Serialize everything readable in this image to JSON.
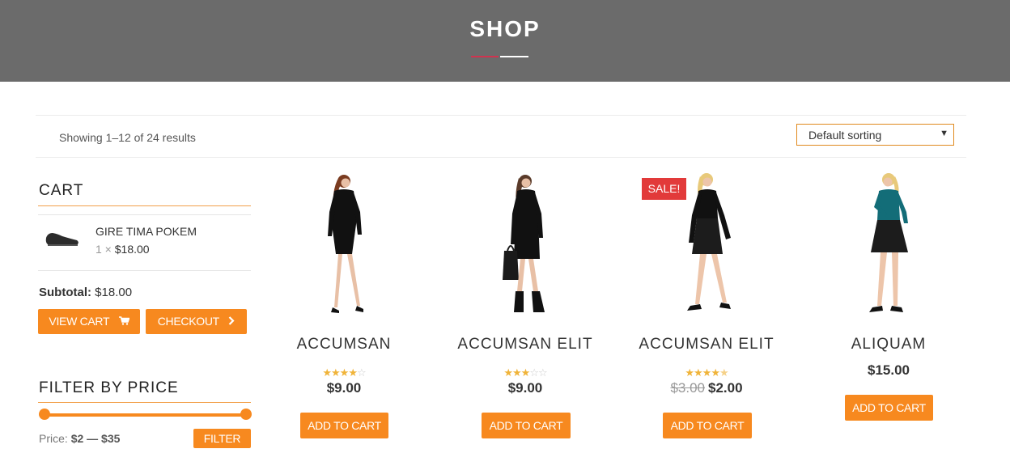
{
  "page": {
    "title": "SHOP"
  },
  "toolbar": {
    "result_count": "Showing 1–12 of 24 results",
    "sort_value": "Default sorting"
  },
  "cart": {
    "title": "CART",
    "item": {
      "name": "GIRE TIMA POKEM",
      "qty": "1 ×",
      "price": "$18.00"
    },
    "subtotal_label": "Subtotal:",
    "subtotal_value": "$18.00",
    "view_cart_label": "VIEW CART",
    "checkout_label": "CHECKOUT"
  },
  "filter": {
    "title": "FILTER BY PRICE",
    "price_label": "Price:",
    "price_range": "$2 — $35",
    "range_min": 2,
    "range_max": 35,
    "button_label": "FILTER"
  },
  "products": [
    {
      "name": "ACCUMSAN",
      "rating": 4,
      "price": "$9.00",
      "old_price": "",
      "button": "ADD TO CART",
      "sale": false
    },
    {
      "name": "ACCUMSAN ELIT",
      "rating": 3,
      "price": "$9.00",
      "old_price": "",
      "button": "ADD TO CART",
      "sale": false
    },
    {
      "name": "ACCUMSAN ELIT",
      "rating": 4.5,
      "price": "$2.00",
      "old_price": "$3.00",
      "button": "ADD TO CART",
      "sale": true,
      "sale_label": "SALE!"
    },
    {
      "name": "ALIQUAM",
      "rating": null,
      "price": "$15.00",
      "old_price": "",
      "button": "ADD TO CART",
      "sale": false
    }
  ],
  "colors": {
    "accent": "#f7891f",
    "header_bg": "#6b6b6b",
    "sale": "#e23a3a",
    "star": "#f0b43a"
  }
}
